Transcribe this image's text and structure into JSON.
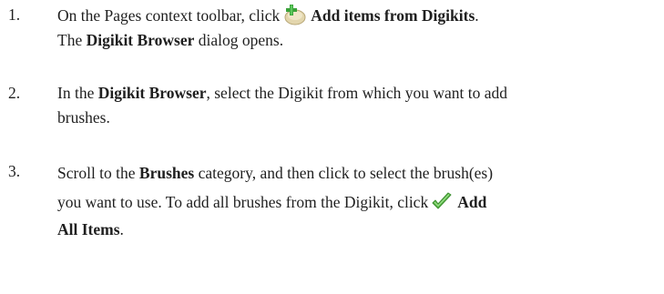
{
  "steps": [
    {
      "number": "1.",
      "line1": {
        "before_icon": "On the Pages context toolbar, click",
        "icon": "add-items-from-digikits-icon",
        "bold_text": "Add items from Digikits",
        "after": "."
      },
      "line2": {
        "before": "The",
        "bold_text": "Digikit Browser",
        "after": "dialog opens."
      }
    },
    {
      "number": "2.",
      "line1": {
        "before": "In the",
        "bold_text": "Digikit Browser",
        "after": ", select the Digikit from which you want to add"
      },
      "line2": {
        "text": "brushes."
      }
    },
    {
      "number": "3.",
      "line1": {
        "before": "Scroll to the",
        "bold_text": "Brushes",
        "after": "category, and then click to select the brush(es)"
      },
      "line2": {
        "before_icon": "you want to use. To add all brushes from the Digikit, click",
        "icon": "checkmark-icon",
        "bold_text": "Add"
      },
      "line3": {
        "bold_text": "All Items",
        "after": "."
      }
    }
  ],
  "colors": {
    "text": "#1f1f1f",
    "add_icon_green": "#3aa23a",
    "add_icon_tan": "#d9c89a",
    "checkmark_green": "#5bb84a"
  }
}
